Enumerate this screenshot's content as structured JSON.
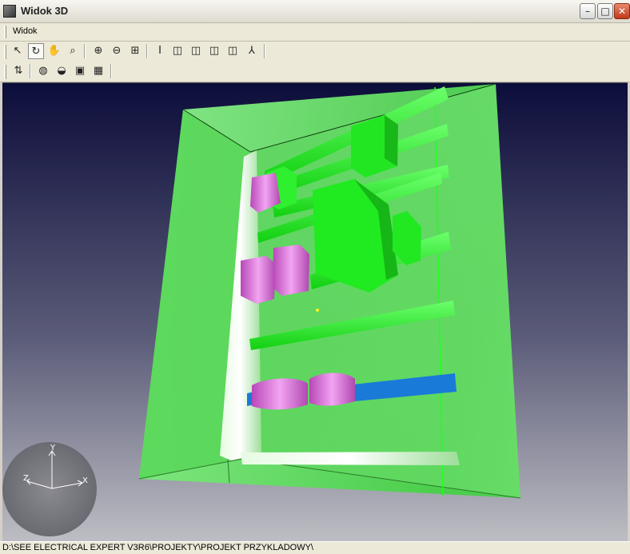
{
  "window": {
    "title": "Widok 3D",
    "min_glyph": "–",
    "max_glyph": "□",
    "close_glyph": "✕"
  },
  "menu": {
    "items": [
      "Widok"
    ]
  },
  "toolbar1": {
    "buttons": [
      {
        "name": "select-arrow-icon",
        "glyph": "↖"
      },
      {
        "name": "rotate-icon",
        "glyph": "↻",
        "active": true
      },
      {
        "name": "pan-hand-icon",
        "glyph": "✋"
      },
      {
        "name": "magnifier-icon",
        "glyph": "⌕"
      },
      {
        "name": "zoom-in-icon",
        "glyph": "⊕"
      },
      {
        "name": "zoom-out-icon",
        "glyph": "⊖"
      },
      {
        "name": "zoom-extents-icon",
        "glyph": "⊞"
      },
      {
        "name": "text-cursor-icon",
        "glyph": "I"
      },
      {
        "name": "view-front-cube-icon",
        "glyph": "◫"
      },
      {
        "name": "view-side-cube-icon",
        "glyph": "◫"
      },
      {
        "name": "view-top-cube-icon",
        "glyph": "◫"
      },
      {
        "name": "view-iso-cube-icon",
        "glyph": "◫"
      },
      {
        "name": "axes-icon",
        "glyph": "⅄"
      }
    ]
  },
  "toolbar2": {
    "buttons": [
      {
        "name": "refresh-arrows-icon",
        "glyph": "⇅"
      },
      {
        "name": "render-globe-icon",
        "glyph": "◍"
      },
      {
        "name": "render-sphere-icon",
        "glyph": "◒"
      },
      {
        "name": "render-box-icon",
        "glyph": "▣"
      },
      {
        "name": "render-film-icon",
        "glyph": "▦"
      }
    ]
  },
  "axes": {
    "x": "X",
    "y": "Y",
    "z": "Z"
  },
  "status": {
    "path": "D:\\SEE ELECTRICAL EXPERT V3R6\\PROJEKTY\\PROJEKT PRZYKLADOWY\\"
  },
  "colors": {
    "cabinet_green": "#5fe15f",
    "component_green": "#22ee22",
    "magenta": "#cc55cc",
    "rail_blue": "#1a7ad8",
    "bg_top": "#0c0d3a",
    "bg_bottom": "#bdbdc3"
  }
}
